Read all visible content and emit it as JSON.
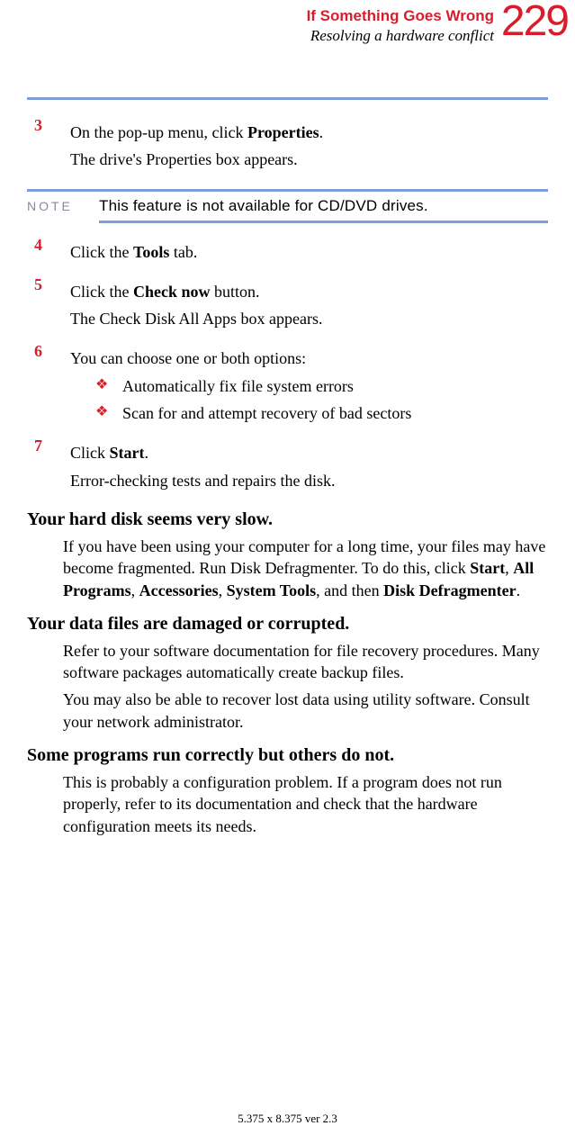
{
  "header": {
    "title": "If Something Goes Wrong",
    "subtitle": "Resolving a hardware conflict",
    "page": "229"
  },
  "steps": {
    "s3": {
      "num": "3",
      "line1a": "On the pop-up menu, click ",
      "line1b": "Properties",
      "line1c": ".",
      "line2": "The drive's Properties box appears."
    },
    "note": {
      "label": "NOTE",
      "text": "This feature is not available for CD/DVD drives."
    },
    "s4": {
      "num": "4",
      "a": "Click the ",
      "b": "Tools",
      "c": " tab."
    },
    "s5": {
      "num": "5",
      "a": "Click the ",
      "b": "Check now",
      "c": " button.",
      "d": "The Check Disk All Apps box appears."
    },
    "s6": {
      "num": "6",
      "a": "You can choose one or both options:",
      "b1": "Automatically fix file system errors",
      "b2": "Scan for and attempt recovery of bad sectors"
    },
    "s7": {
      "num": "7",
      "a": "Click ",
      "b": "Start",
      "c": ".",
      "d": "Error-checking tests and repairs the disk."
    }
  },
  "sections": {
    "slow": {
      "h": "Your hard disk seems very slow.",
      "p1a": "If you have been using your computer for a long time, your files may have become fragmented. Run Disk Defragmenter. To do this, click ",
      "p1b": "Start",
      "p1c": ", ",
      "p1d": "All Programs",
      "p1e": ", ",
      "p1f": "Accessories",
      "p1g": ", ",
      "p1h": "System Tools",
      "p1i": ", and then ",
      "p1j": "Disk Defragmenter",
      "p1k": "."
    },
    "damaged": {
      "h": "Your data files are damaged or corrupted.",
      "p1": "Refer to your software documentation for file recovery procedures. Many software packages automatically create backup files.",
      "p2": "You may also be able to recover lost data using utility software. Consult your network administrator."
    },
    "programs": {
      "h": "Some programs run correctly but others do not.",
      "p1": "This is probably a configuration problem. If a program does not run properly, refer to its documentation and check that the hardware configuration meets its needs."
    }
  },
  "footer": "5.375 x 8.375 ver 2.3"
}
